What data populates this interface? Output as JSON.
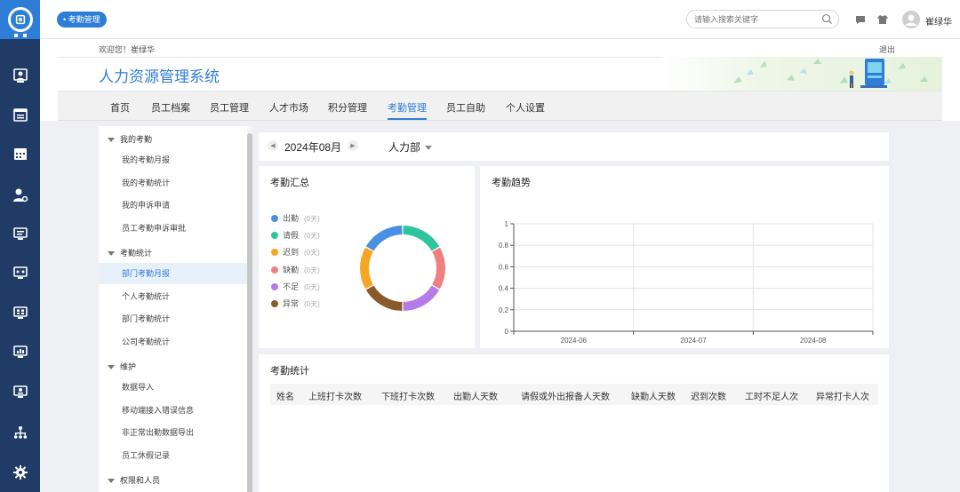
{
  "topbar": {
    "tag": "考勤管理",
    "search_placeholder": "请输入搜索关键字",
    "user_name": "崔绿华"
  },
  "header": {
    "welcome": "欢迎您！崔绿华",
    "logout": "退出",
    "system_title": "人力资源管理系统",
    "nav": [
      "首页",
      "员工档案",
      "员工管理",
      "人才市场",
      "积分管理",
      "考勤管理",
      "员工自助",
      "个人设置"
    ],
    "active_nav": "考勤管理"
  },
  "sidebar": {
    "groups": [
      {
        "label": "我的考勤",
        "items": [
          "我的考勤月报",
          "我的考勤统计",
          "我的申诉申请",
          "员工考勤申诉审批"
        ]
      },
      {
        "label": "考勤统计",
        "items": [
          "部门考勤月报",
          "个人考勤统计",
          "部门考勤统计",
          "公司考勤统计"
        ]
      },
      {
        "label": "维护",
        "items": [
          "数据导入",
          "移动端接入错误信息",
          "非正常出勤数据导出",
          "员工休假记录"
        ]
      },
      {
        "label": "权限和人员",
        "items": []
      }
    ],
    "active_item": "部门考勤月报"
  },
  "filter": {
    "month": "2024年08月",
    "department": "人力部"
  },
  "summary": {
    "title": "考勤汇总",
    "items": [
      {
        "label": "出勤",
        "value": "(0天)",
        "color": "#4a90e2"
      },
      {
        "label": "请假",
        "value": "(0天)",
        "color": "#2ec4a0"
      },
      {
        "label": "迟到",
        "value": "(0天)",
        "color": "#f5a623"
      },
      {
        "label": "缺勤",
        "value": "(0天)",
        "color": "#f08080"
      },
      {
        "label": "不足",
        "value": "(0天)",
        "color": "#b57be8"
      },
      {
        "label": "异常",
        "value": "(0天)",
        "color": "#8b5a2b"
      }
    ]
  },
  "trend": {
    "title": "考勤趋势"
  },
  "chart_data": {
    "type": "line",
    "categories": [
      "2024-06",
      "2024-07",
      "2024-08"
    ],
    "series": [],
    "y_ticks": [
      "0",
      "0.2",
      "0.4",
      "0.6",
      "0.8",
      "1"
    ],
    "ylim": [
      0,
      1
    ],
    "grid": true
  },
  "stats": {
    "title": "考勤统计",
    "columns": [
      "姓名",
      "上班打卡次数",
      "下班打卡次数",
      "出勤人天数",
      "请假或外出报备人天数",
      "缺勤人天数",
      "迟到次数",
      "工时不足人次",
      "异常打卡人次"
    ]
  },
  "colors": {
    "accent": "#2e7ed8",
    "rail": "#1f3b66"
  }
}
